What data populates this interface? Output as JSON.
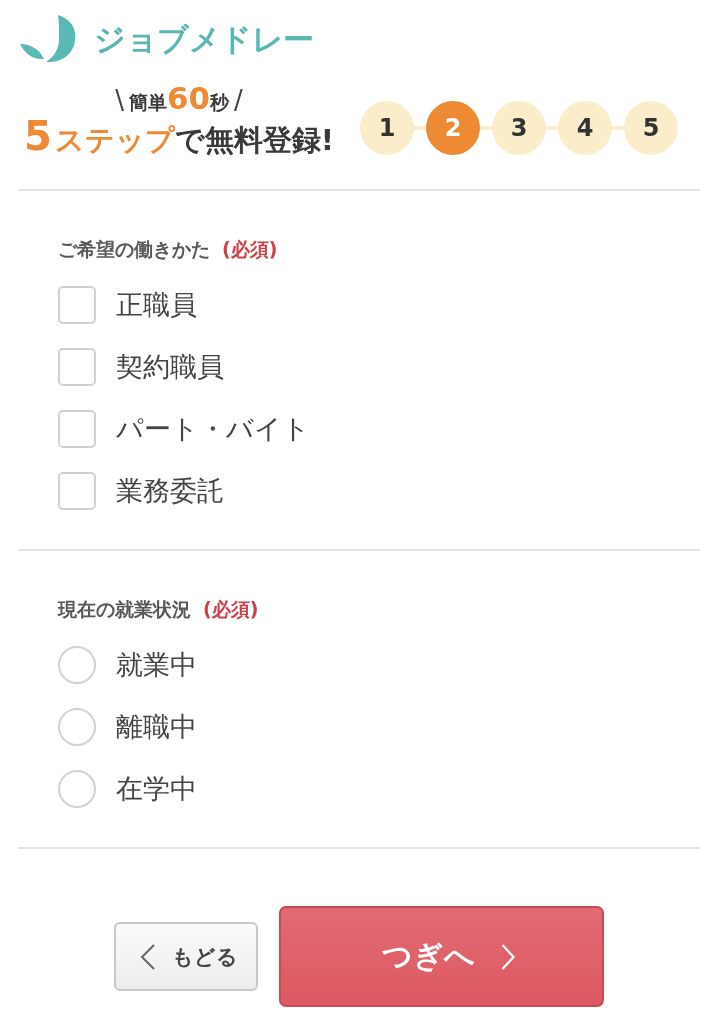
{
  "logo": {
    "text": "ジョブメドレー"
  },
  "tagline": {
    "lines": [
      [
        {
          "text": "\\",
          "kind": "slash"
        },
        {
          "text": "簡単",
          "kind": "small"
        },
        {
          "text": "60",
          "kind": "accent"
        },
        {
          "text": "秒",
          "kind": "small"
        },
        {
          "text": "/",
          "kind": "slash"
        }
      ],
      [
        {
          "text": "5",
          "kind": "big_accent"
        },
        {
          "text": "ステップ",
          "kind": "accent"
        },
        {
          "text": "で無料登録!",
          "kind": "strong"
        }
      ]
    ]
  },
  "steps": [
    {
      "label": "1",
      "current": false
    },
    {
      "label": "2",
      "current": true
    },
    {
      "label": "3",
      "current": false
    },
    {
      "label": "4",
      "current": false
    },
    {
      "label": "5",
      "current": false
    }
  ],
  "sections": [
    {
      "title": "ご希望の働きかた",
      "required": "(必須)",
      "kind": "checkbox",
      "options": [
        {
          "label": "正職員",
          "checked": false
        },
        {
          "label": "契約職員",
          "checked": false
        },
        {
          "label": "パート・バイト",
          "checked": false
        },
        {
          "label": "業務委託",
          "checked": false
        }
      ]
    },
    {
      "title": "現在の就業状況",
      "required": "(必須)",
      "kind": "radio",
      "options": [
        {
          "label": "就業中",
          "selected": false
        },
        {
          "label": "離職中",
          "selected": false
        },
        {
          "label": "在学中",
          "selected": false
        }
      ]
    }
  ],
  "buttons": [
    {
      "label": "もどる",
      "kind": "back"
    },
    {
      "label": "つぎへ",
      "kind": "next"
    }
  ]
}
